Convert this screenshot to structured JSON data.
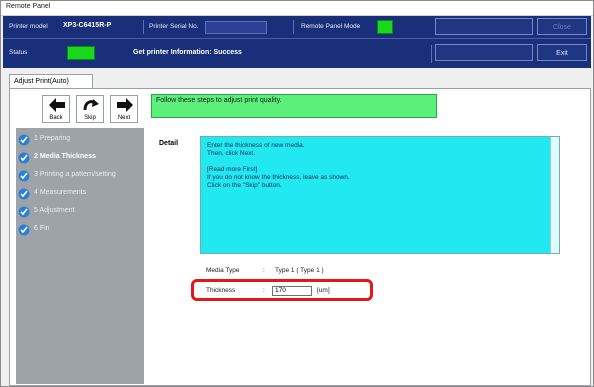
{
  "window": {
    "title": "Remote Panel"
  },
  "header": {
    "printer_model_label": "Printer model",
    "printer_model_value": "XP3-C6415R-P",
    "printer_serial_label": "Printer Serial No.",
    "remote_panel_mode_label": "Remote Panel Mode",
    "status_label": "Status",
    "status_text": "Get printer Information: Success",
    "buttons": [
      "",
      "Close",
      "",
      "Exit"
    ],
    "status_color": "#19d719"
  },
  "tab": {
    "label": "Adjust Print(Auto)"
  },
  "nav": {
    "back": "Back",
    "skip": "Skip",
    "next": "Next"
  },
  "instruction": "Follow these steps to adjust print quality.",
  "steps": [
    {
      "label": "1 Preparing",
      "state": "done"
    },
    {
      "label": "2 Media Thickness",
      "state": "active"
    },
    {
      "label": "3 Printing a pattern/setting",
      "state": "pending"
    },
    {
      "label": "4 Measurements",
      "state": "pending"
    },
    {
      "label": "5 Adjustment",
      "state": "pending"
    },
    {
      "label": "6 Fin",
      "state": "pending"
    }
  ],
  "detail": {
    "label": "Detail",
    "lines": [
      "Enter the thickness of new media.",
      "Then, click Next.",
      "",
      "[Read more First]",
      "If you do not know the thickness, leave as shown.",
      "Click on the \"Skip\" button."
    ]
  },
  "media_type": {
    "label": "Media Type",
    "separator": ":",
    "value": "Type 1 ( Type 1 )"
  },
  "thickness": {
    "label": "Thickness",
    "separator": ":",
    "value": "170",
    "unit": "[um]"
  },
  "colors": {
    "header_bg": "#1a2f7a",
    "instruction_bg": "#5cf07a",
    "detail_bg": "#22e8f0",
    "sidebar_bg": "#9ea3a8",
    "highlight": "#e01818"
  }
}
